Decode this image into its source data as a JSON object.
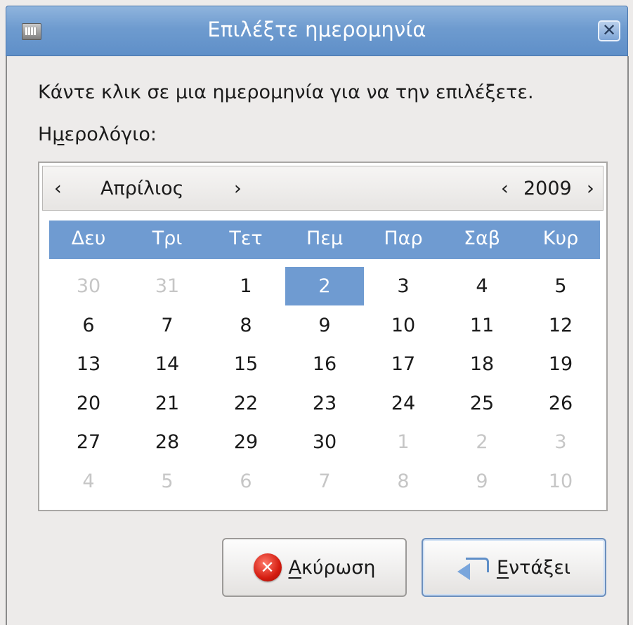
{
  "window": {
    "title": "Επιλέξτε ημερομηνία",
    "close_label": "✕"
  },
  "instruction": "Κάντε κλικ σε μια ημερομηνία για να την επιλέξετε.",
  "calendar_label": {
    "before": "Η",
    "mnemonic": "μ",
    "after": "ερολόγιο:"
  },
  "calendar": {
    "month": "Απρίλιος",
    "year": "2009",
    "prev_month": "‹",
    "next_month": "›",
    "prev_year": "‹",
    "next_year": "›",
    "weekdays": [
      "Δευ",
      "Τρι",
      "Τετ",
      "Πεμ",
      "Παρ",
      "Σαβ",
      "Κυρ"
    ],
    "weeks": [
      [
        "30",
        "31",
        "1",
        "2",
        "3",
        "4",
        "5"
      ],
      [
        "6",
        "7",
        "8",
        "9",
        "10",
        "11",
        "12"
      ],
      [
        "13",
        "14",
        "15",
        "16",
        "17",
        "18",
        "19"
      ],
      [
        "20",
        "21",
        "22",
        "23",
        "24",
        "25",
        "26"
      ],
      [
        "27",
        "28",
        "29",
        "30",
        "1",
        "2",
        "3"
      ],
      [
        "4",
        "5",
        "6",
        "7",
        "8",
        "9",
        "10"
      ]
    ],
    "selected": "2",
    "colors": {
      "header_bg": "#6f9bd1",
      "selected_bg": "#6f9bd1",
      "other_month_text": "#c6c6c6"
    }
  },
  "buttons": {
    "cancel": {
      "mnemonic": "Α",
      "rest": "κύρωση",
      "icon": "cancel-icon"
    },
    "ok": {
      "mnemonic": "Ε",
      "rest": "ντάξει",
      "icon": "ok-arrow-icon"
    }
  }
}
